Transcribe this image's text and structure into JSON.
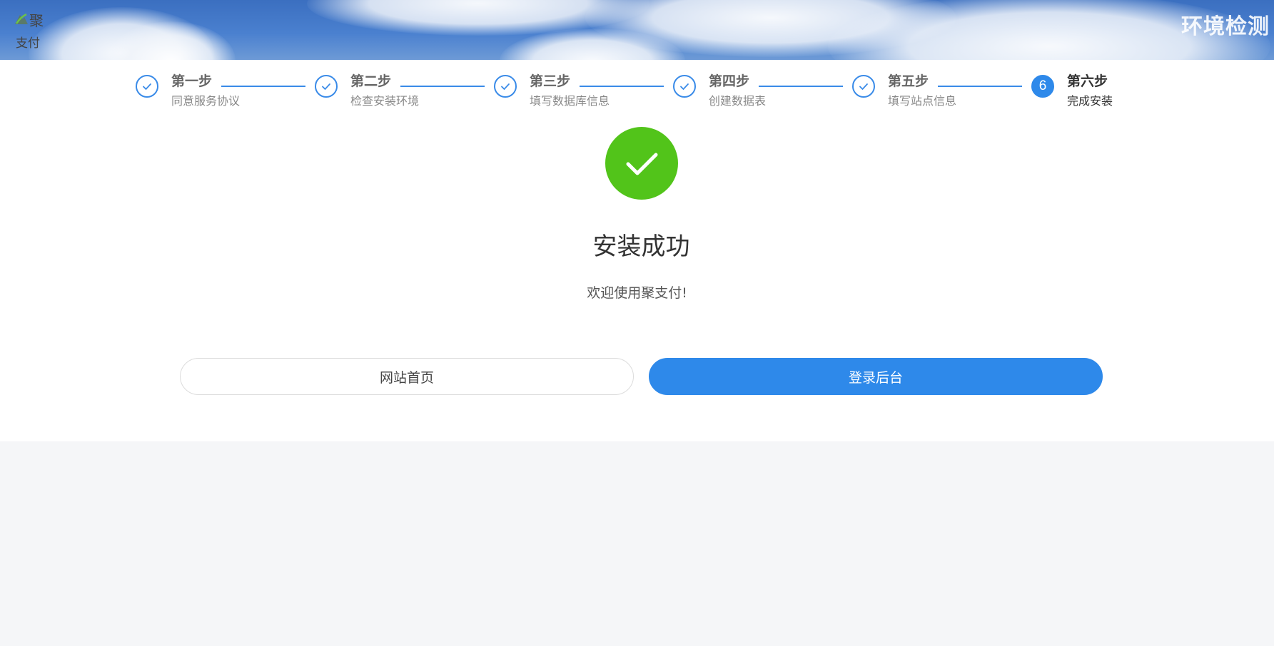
{
  "header": {
    "logo_line1": "聚",
    "logo_line2": "支付",
    "title": "环境检测"
  },
  "steps": [
    {
      "title": "第一步",
      "desc": "同意服务协议",
      "status": "done"
    },
    {
      "title": "第二步",
      "desc": "检查安装环境",
      "status": "done"
    },
    {
      "title": "第三步",
      "desc": "填写数据库信息",
      "status": "done"
    },
    {
      "title": "第四步",
      "desc": "创建数据表",
      "status": "done"
    },
    {
      "title": "第五步",
      "desc": "填写站点信息",
      "status": "done"
    },
    {
      "title": "第六步",
      "desc": "完成安装",
      "status": "current",
      "number": "6"
    }
  ],
  "result": {
    "title": "安装成功",
    "subtitle": "欢迎使用聚支付!"
  },
  "buttons": {
    "home_label": "网站首页",
    "admin_label": "登录后台"
  },
  "colors": {
    "accent": "#2e89ea",
    "success": "#52c41a",
    "header_sky": "#4a80cf"
  }
}
